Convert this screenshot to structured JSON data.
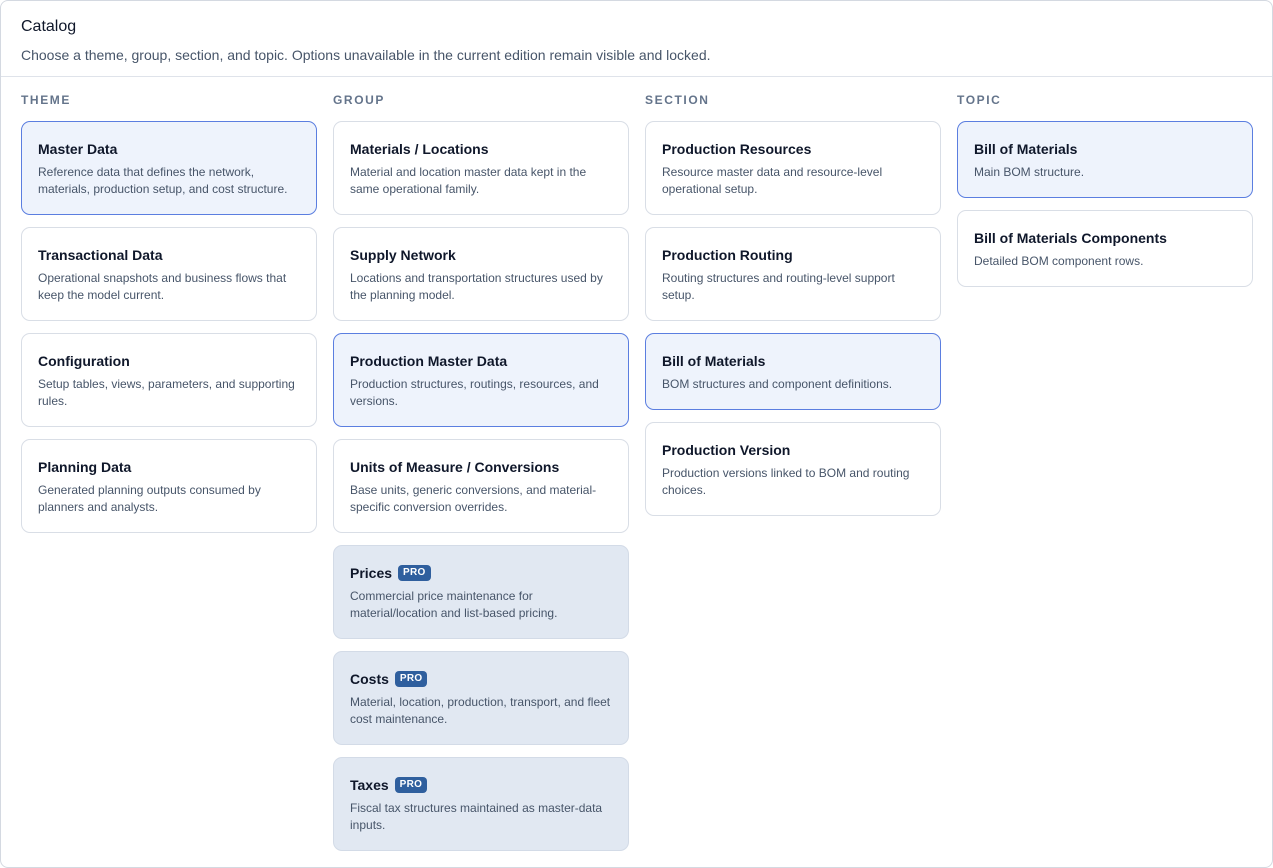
{
  "catalog": {
    "title": "Catalog",
    "subtitle": "Choose a theme, group, section, and topic. Options unavailable in the current edition remain visible and locked."
  },
  "columns": {
    "theme": {
      "heading": "THEME"
    },
    "group": {
      "heading": "GROUP"
    },
    "section": {
      "heading": "SECTION"
    },
    "topic": {
      "heading": "TOPIC"
    }
  },
  "theme": [
    {
      "title": "Master Data",
      "desc": "Reference data that defines the network, materials, production setup, and cost structure.",
      "state": "selected"
    },
    {
      "title": "Transactional Data",
      "desc": "Operational snapshots and business flows that keep the model current.",
      "state": "normal"
    },
    {
      "title": "Configuration",
      "desc": "Setup tables, views, parameters, and supporting rules.",
      "state": "normal"
    },
    {
      "title": "Planning Data",
      "desc": "Generated planning outputs consumed by planners and analysts.",
      "state": "normal"
    }
  ],
  "group": [
    {
      "title": "Materials / Locations",
      "desc": "Material and location master data kept in the same operational family.",
      "state": "normal"
    },
    {
      "title": "Supply Network",
      "desc": "Locations and transportation structures used by the planning model.",
      "state": "normal"
    },
    {
      "title": "Production Master Data",
      "desc": "Production structures, routings, resources, and versions.",
      "state": "selected"
    },
    {
      "title": "Units of Measure / Conversions",
      "desc": "Base units, generic conversions, and material-specific conversion overrides.",
      "state": "normal"
    },
    {
      "title": "Prices",
      "badge": "PRO",
      "desc": "Commercial price maintenance for material/location and list-based pricing.",
      "state": "locked"
    },
    {
      "title": "Costs",
      "badge": "PRO",
      "desc": "Material, location, production, transport, and fleet cost maintenance.",
      "state": "locked"
    },
    {
      "title": "Taxes",
      "badge": "PRO",
      "desc": "Fiscal tax structures maintained as master-data inputs.",
      "state": "locked"
    }
  ],
  "section": [
    {
      "title": "Production Resources",
      "desc": "Resource master data and resource-level operational setup.",
      "state": "normal"
    },
    {
      "title": "Production Routing",
      "desc": "Routing structures and routing-level support setup.",
      "state": "normal"
    },
    {
      "title": "Bill of Materials",
      "desc": "BOM structures and component definitions.",
      "state": "selected"
    },
    {
      "title": "Production Version",
      "desc": "Production versions linked to BOM and routing choices.",
      "state": "normal"
    }
  ],
  "topic": [
    {
      "title": "Bill of Materials",
      "desc": "Main BOM structure.",
      "state": "selected"
    },
    {
      "title": "Bill of Materials Components",
      "desc": "Detailed BOM component rows.",
      "state": "normal"
    }
  ],
  "colors": {
    "selected_bg": "#eef3fc",
    "selected_border": "#5b7ee0",
    "locked_bg": "#e1e8f2",
    "badge_bg": "#2f5f9e"
  }
}
